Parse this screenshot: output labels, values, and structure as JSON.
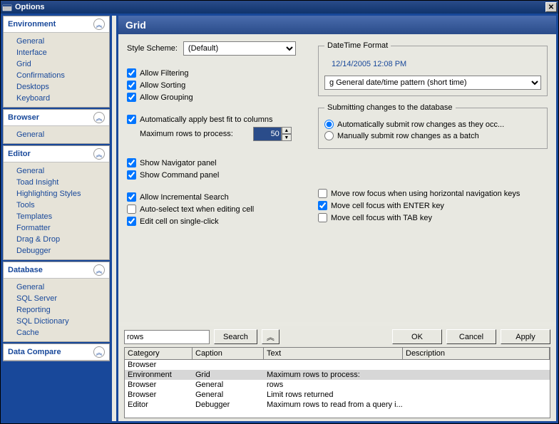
{
  "title": "Options",
  "page": "Grid",
  "sidebar": [
    {
      "name": "Environment",
      "items": [
        "General",
        "Interface",
        "Grid",
        "Confirmations",
        "Desktops",
        "Keyboard"
      ]
    },
    {
      "name": "Browser",
      "items": [
        "General"
      ]
    },
    {
      "name": "Editor",
      "items": [
        "General",
        "Toad Insight",
        "Highlighting Styles",
        "Tools",
        "Templates",
        "Formatter",
        "Drag & Drop",
        "Debugger"
      ]
    },
    {
      "name": "Database",
      "items": [
        "General",
        "SQL Server",
        "Reporting",
        "SQL Dictionary",
        "Cache"
      ]
    },
    {
      "name": "Data Compare",
      "items": []
    }
  ],
  "form": {
    "styleSchemeLabel": "Style Scheme:",
    "styleScheme": "(Default)",
    "allowFiltering": "Allow Filtering",
    "allowSorting": "Allow Sorting",
    "allowGrouping": "Allow Grouping",
    "autoBestFit": "Automatically apply best fit to columns",
    "maxRowsLabel": "Maximum rows to process:",
    "maxRows": "50",
    "showNavigator": "Show Navigator panel",
    "showCommand": "Show Command panel",
    "incrementalSearch": "Allow Incremental Search",
    "autoSelectText": "Auto-select text when editing cell",
    "editSingleClick": "Edit cell on single-click",
    "dtLegend": "DateTime Format",
    "dtPreview": "12/14/2005 12:08 PM",
    "dtFormat": "g General date/time pattern (short time)",
    "submitLegend": "Submitting changes to the database",
    "autoSubmit": "Automatically submit row changes as they occ...",
    "manualSubmit": "Manually submit row changes as a batch",
    "moveRowFocus": "Move row focus when using horizontal navigation keys",
    "moveCellEnter": "Move cell focus with ENTER key",
    "moveCellTab": "Move cell focus with TAB key"
  },
  "footer": {
    "searchValue": "rows",
    "searchBtn": "Search",
    "ok": "OK",
    "cancel": "Cancel",
    "apply": "Apply"
  },
  "results": {
    "headers": [
      "Category",
      "Caption",
      "Text",
      "Description"
    ],
    "rows": [
      {
        "cat": "Browser",
        "cap": "",
        "txt": "",
        "desc": ""
      },
      {
        "cat": "Environment",
        "cap": "Grid",
        "txt": "Maximum rows to process:",
        "desc": "",
        "sel": true
      },
      {
        "cat": "Browser",
        "cap": "General",
        "txt": "rows",
        "desc": ""
      },
      {
        "cat": "Browser",
        "cap": "General",
        "txt": "Limit rows returned",
        "desc": ""
      },
      {
        "cat": "Editor",
        "cap": "Debugger",
        "txt": "Maximum rows to read from a query i...",
        "desc": ""
      }
    ]
  }
}
